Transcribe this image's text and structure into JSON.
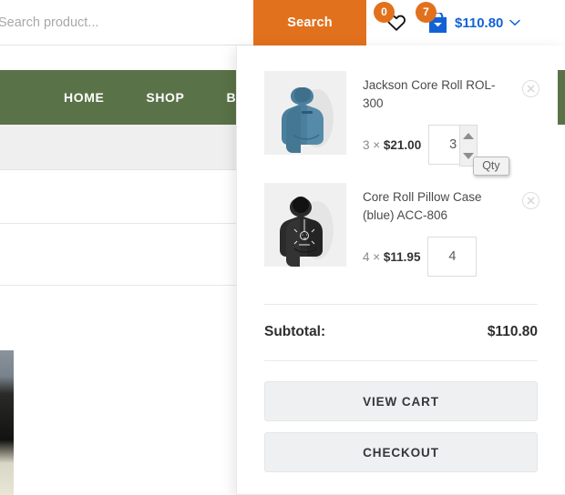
{
  "header": {
    "search": {
      "placeholder": "Search product...",
      "value": "",
      "button_label": "Search"
    },
    "wishlist": {
      "count": "0",
      "icon": "heart-icon"
    },
    "cart": {
      "count": "7",
      "icon": "shopping-bag-icon",
      "amount": "$110.80",
      "chevron": "⌄"
    }
  },
  "nav": {
    "items": [
      {
        "label": "HOME"
      },
      {
        "label": "SHOP"
      },
      {
        "label": "BLOG"
      }
    ],
    "background_color": "#5a7247"
  },
  "mini_cart": {
    "items": [
      {
        "name": "Jackson Core Roll ROL-300",
        "qty_label": "3 × ",
        "price": "$21.00",
        "qty_value": "3",
        "has_spinner": true,
        "tooltip": "Qty",
        "remove_icon": "close-circle-icon",
        "thumbnail": "blue-hoodie-back"
      },
      {
        "name": "Core Roll Pillow Case (blue) ACC-806",
        "qty_label": "4 × ",
        "price": "$11.95",
        "qty_value": "4",
        "has_spinner": false,
        "tooltip": "",
        "remove_icon": "close-circle-icon",
        "thumbnail": "black-graphic-hoodie"
      }
    ],
    "subtotal_label": "Subtotal:",
    "subtotal_value": "$110.80",
    "view_cart_label": "VIEW CART",
    "checkout_label": "CHECKOUT"
  },
  "colors": {
    "accent_orange": "#e2711d",
    "nav_green": "#5a7247",
    "cart_blue": "#1262d6",
    "button_grey": "#eef0f2"
  }
}
